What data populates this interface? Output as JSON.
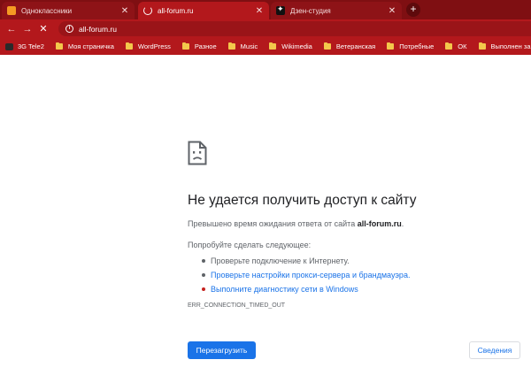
{
  "tabs": [
    {
      "title": "Одноклассники",
      "close": "✕"
    },
    {
      "title": "all-forum.ru",
      "close": "✕"
    },
    {
      "title": "Дзен-студия",
      "close": "✕"
    }
  ],
  "new_tab": "+",
  "toolbar": {
    "back": "←",
    "forward": "→",
    "stop": "✕",
    "url": "all-forum.ru",
    "info": "i"
  },
  "bookmarks": [
    "3G Tele2",
    "Моя страничка",
    "WordPress",
    "Разное",
    "Music",
    "Wikimedia",
    "Ветеранская",
    "Потребные",
    "ОК",
    "Выполнен заказ"
  ],
  "error": {
    "title": "Не удается получить доступ к сайту",
    "desc_prefix": "Превышено время ожидания ответа от сайта ",
    "site": "all-forum.ru",
    "desc_suffix": ".",
    "try_heading": "Попробуйте сделать следующее:",
    "suggestions": [
      "Проверьте подключение к Интернету.",
      "Проверьте настройки прокси-сервера и брандмауэра.",
      "Выполните диагностику сети в Windows"
    ],
    "code": "ERR_CONNECTION_TIMED_OUT",
    "reload": "Перезагрузить",
    "details": "Сведения"
  },
  "colors": {
    "tab_strip": "#7f0f12",
    "toolbar": "#b3181c",
    "link": "#1a73e8",
    "button": "#1a73e8"
  }
}
